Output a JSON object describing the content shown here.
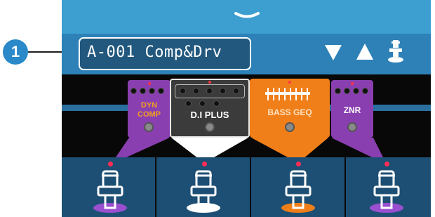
{
  "callout": {
    "number": "1"
  },
  "patch": {
    "name": "A-001 Comp&Drv"
  },
  "header_icons": [
    "arrow-down-icon",
    "arrow-up-icon",
    "footswitch-icon"
  ],
  "effects": [
    {
      "id": "dyn-comp",
      "label_line1": "DYN",
      "label_line2": "COMP",
      "color": "#8a3fb0",
      "label_color": "#f0a020"
    },
    {
      "id": "dj-plus",
      "label_line1": "D.I PLUS",
      "color": "#3b3b3b",
      "label_color": "#ffffff"
    },
    {
      "id": "bass-geq",
      "label_line1": "BASS GEQ",
      "color": "#f07f1a",
      "label_color": "#ffe2c2"
    },
    {
      "id": "znr",
      "label_line1": "ZNR",
      "color": "#8a3fb0",
      "label_color": "#ffffff"
    }
  ],
  "footswitch_colors": [
    "#9a4fd0",
    "#ffffff",
    "#f07f1a",
    "#9a4fd0"
  ],
  "colors": {
    "top_bar": "#3d9ed0",
    "patch_bar": "#2d81b7",
    "accent_red": "#ff2d55"
  }
}
